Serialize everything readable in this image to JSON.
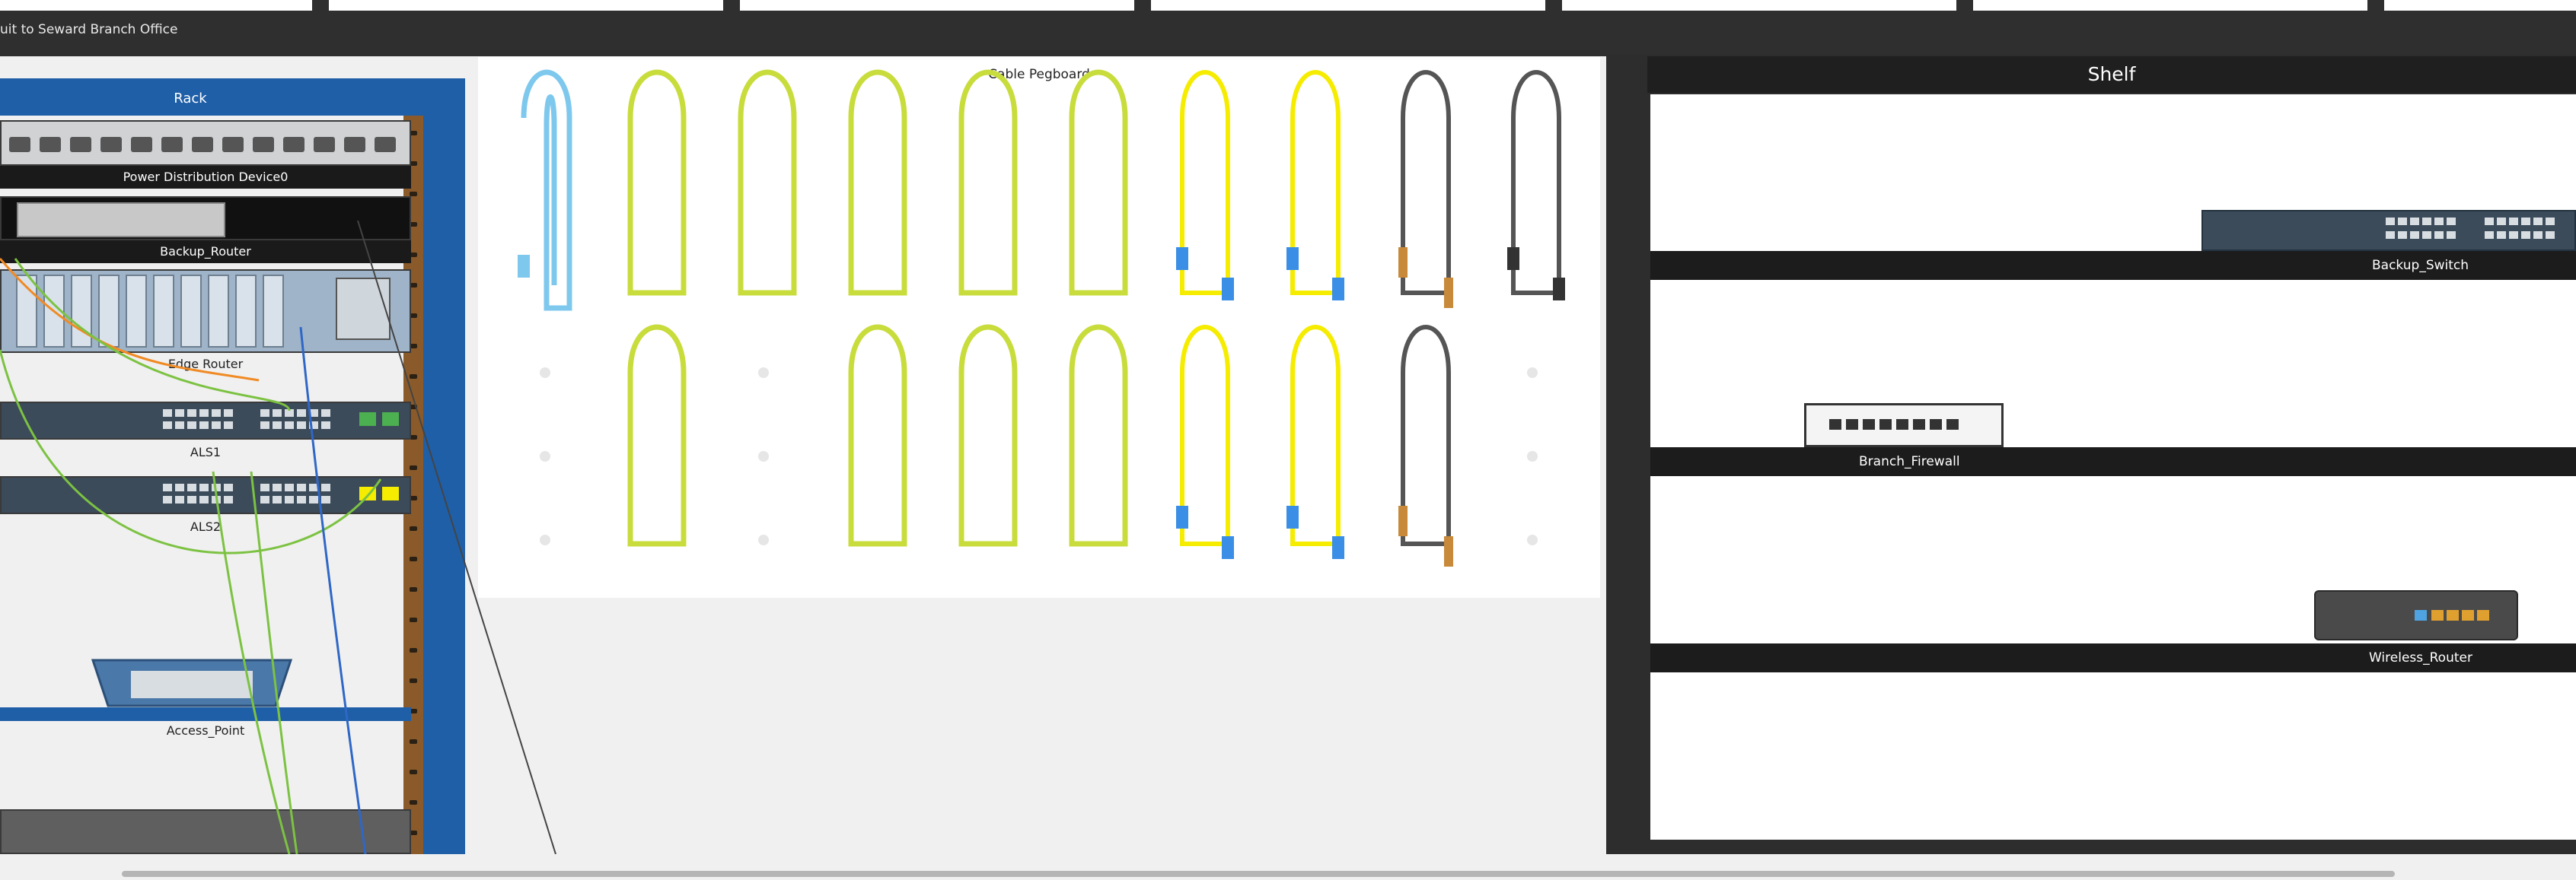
{
  "nav": {
    "return_label": "uit to Seward Branch Office"
  },
  "rack": {
    "title": "Rack",
    "devices": {
      "pdu": "Power Distribution Device0",
      "backup_router": "Backup_Router",
      "edge_router": "Edge Router",
      "als1": "ALS1",
      "als2": "ALS2",
      "access_point": "Access_Point"
    }
  },
  "pegboard": {
    "title": "Cable Pegboard",
    "colors": {
      "straight": "#c8dc3c",
      "fiber": "#f5ec00",
      "console": "#7ec8ee",
      "coax": "#555555",
      "usb": "#555555"
    }
  },
  "shelf": {
    "title": "Shelf",
    "devices": {
      "backup_switch": "Backup_Switch",
      "branch_firewall": "Branch_Firewall",
      "wireless_router": "Wireless_Router"
    }
  }
}
